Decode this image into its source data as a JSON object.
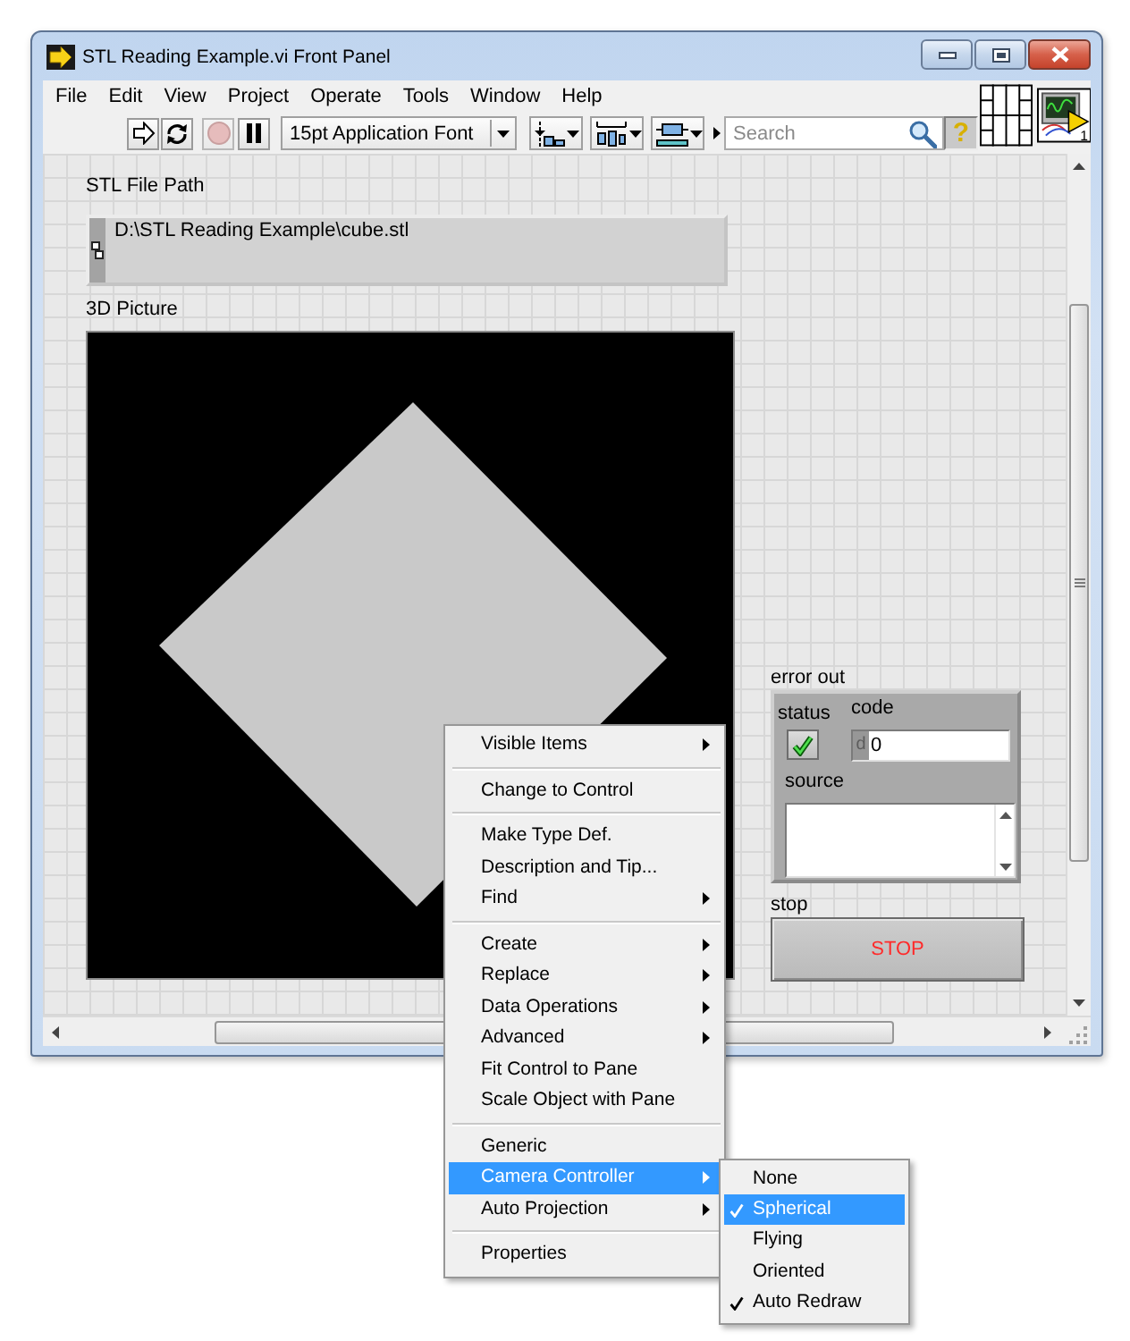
{
  "window": {
    "title": "STL Reading Example.vi Front Panel"
  },
  "menu_bar": [
    "File",
    "Edit",
    "View",
    "Project",
    "Operate",
    "Tools",
    "Window",
    "Help"
  ],
  "toolbar": {
    "run_buttons": [
      {
        "kind": "run",
        "disabled": false
      },
      {
        "kind": "run_continuously",
        "disabled": false
      },
      {
        "kind": "abort",
        "disabled": true
      },
      {
        "kind": "pause",
        "disabled": false
      }
    ],
    "font": "15pt Application Font",
    "layout_tools": [
      {
        "kind": "align"
      },
      {
        "kind": "distribute"
      },
      {
        "kind": "resize"
      }
    ],
    "search": {
      "placeholder": "Search"
    },
    "help": {
      "label": "?",
      "selected": true
    }
  },
  "icon_pane": {
    "vi_icon_text": "1"
  },
  "front_panel": {
    "path_control": {
      "label": "STL File Path",
      "value": "D:\\STL Reading Example\\cube.stl"
    },
    "picture": {
      "label": "3D Picture"
    },
    "error_out": {
      "label": "error out",
      "status_label": "status",
      "status": false,
      "code_label": "code",
      "radix": "d",
      "code": "0",
      "source_label": "source"
    },
    "stop_button": {
      "label": "stop",
      "text": "STOP"
    }
  },
  "context_menu": {
    "groups": [
      [
        {
          "label": "Visible Items",
          "submenu": true,
          "selected": false
        }
      ],
      [
        {
          "label": "Change to Control",
          "submenu": false,
          "selected": false
        }
      ],
      [
        {
          "label": "Make Type Def.",
          "submenu": false,
          "selected": false
        },
        {
          "label": "Description and Tip...",
          "submenu": false,
          "selected": false
        },
        {
          "label": "Find",
          "submenu": true,
          "selected": false
        }
      ],
      [
        {
          "label": "Create",
          "submenu": true,
          "selected": false
        },
        {
          "label": "Replace",
          "submenu": true,
          "selected": false
        },
        {
          "label": "Data Operations",
          "submenu": true,
          "selected": false
        },
        {
          "label": "Advanced",
          "submenu": true,
          "selected": false
        },
        {
          "label": "Fit Control to Pane",
          "submenu": false,
          "selected": false
        },
        {
          "label": "Scale Object with Pane",
          "submenu": false,
          "selected": false
        }
      ],
      [
        {
          "label": "Generic",
          "submenu": false,
          "selected": false
        },
        {
          "label": "Camera Controller",
          "submenu": true,
          "selected": true
        },
        {
          "label": "Auto Projection",
          "submenu": true,
          "selected": false
        }
      ],
      [
        {
          "label": "Properties",
          "submenu": false,
          "selected": false
        }
      ]
    ],
    "open_submenu": {
      "items": [
        {
          "label": "None",
          "checked": false,
          "selected": false
        },
        {
          "label": "Spherical",
          "checked": true,
          "selected": true
        },
        {
          "label": "Flying",
          "checked": false,
          "selected": false
        },
        {
          "label": "Oriented",
          "checked": false,
          "selected": false
        },
        {
          "label": "Auto Redraw",
          "checked": true,
          "selected": false
        }
      ]
    }
  }
}
